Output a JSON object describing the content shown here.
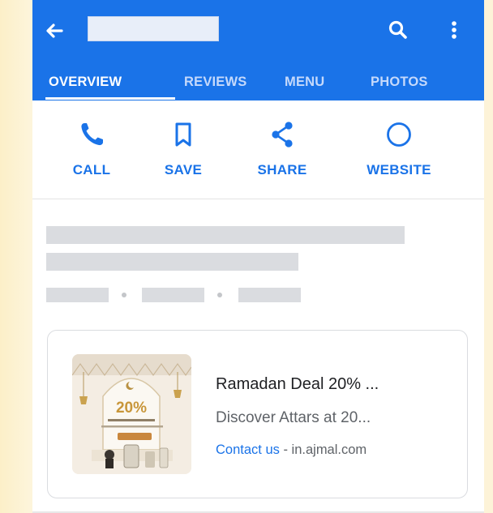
{
  "appbar": {
    "tabs": [
      {
        "label": "OVERVIEW",
        "active": true
      },
      {
        "label": "REVIEWS",
        "active": false
      },
      {
        "label": "MENU",
        "active": false
      },
      {
        "label": "PHOTOS",
        "active": false
      }
    ]
  },
  "actions": [
    {
      "label": "CALL",
      "icon": "phone-icon"
    },
    {
      "label": "SAVE",
      "icon": "bookmark-icon"
    },
    {
      "label": "SHARE",
      "icon": "share-icon"
    },
    {
      "label": "WEBSITE",
      "icon": "globe-icon"
    }
  ],
  "ad": {
    "title": "Ramadan Deal 20% ...",
    "description": "Discover Attars at 20...",
    "cta": "Contact us",
    "separator": " - ",
    "domain": "in.ajmal.com",
    "image": {
      "discount": "20%",
      "icon": "ramadan-offer-image"
    }
  },
  "colors": {
    "accent": "#1a73e8",
    "skeleton": "#dadce0",
    "background_strip": "#fdf6df"
  }
}
